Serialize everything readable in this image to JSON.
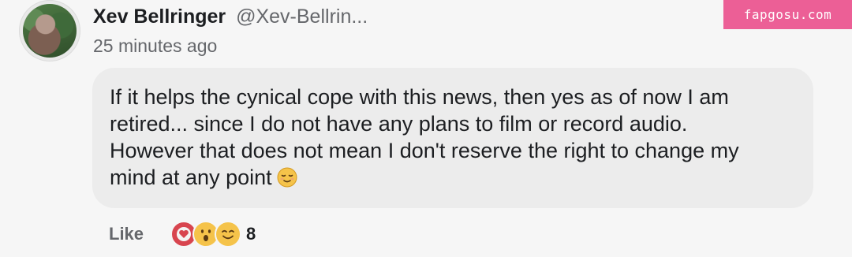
{
  "comment": {
    "author_name": "Xev Bellringer",
    "author_handle": "@Xev-Bellrin...",
    "timestamp": "25 minutes ago",
    "text": "If it helps the cynical cope with this news, then yes as of now I am\nretired... since I do not have any plans to film or record audio.\nHowever that does not mean I don't reserve the right to change my\nmind at any point",
    "text_emoji": "relieved-face-emoji"
  },
  "footer": {
    "like_label": "Like",
    "reactions": [
      "heart-icon",
      "wow-face-icon",
      "smile-face-icon"
    ],
    "reaction_count": "8"
  },
  "watermark": {
    "text": "fapgosu.com"
  },
  "colors": {
    "bubble": "#ececec",
    "watermark_bg": "#ec5f96",
    "heart": "#d8454f",
    "emoji_yellow": "#f5c34a"
  }
}
